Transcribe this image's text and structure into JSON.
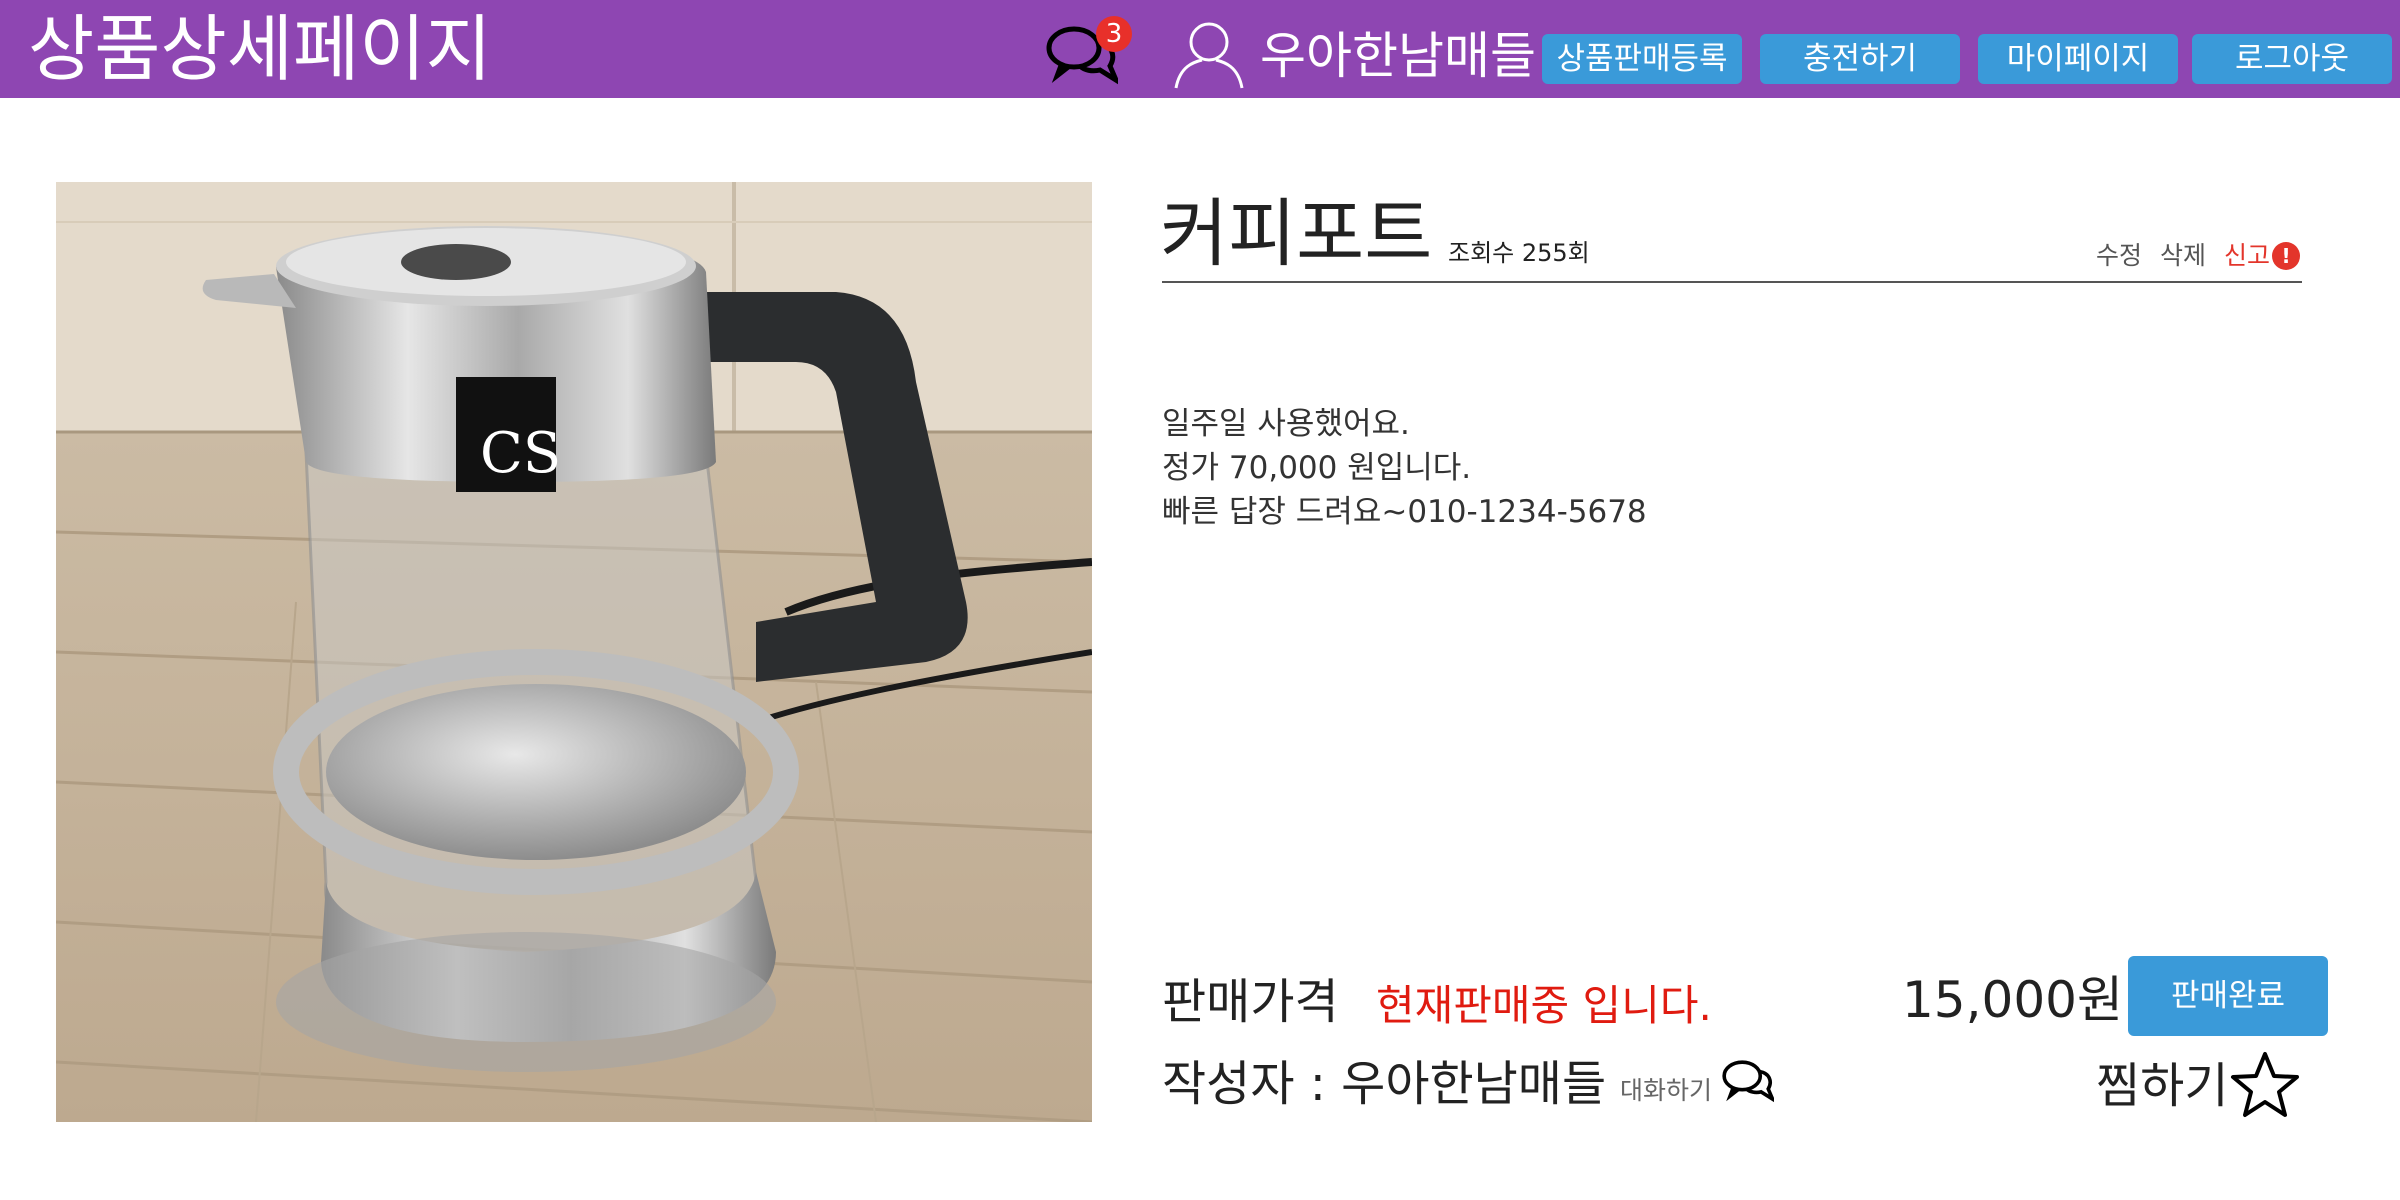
{
  "header": {
    "title": "상품상세페이지",
    "chat_badge_count": "3",
    "user_name": "우아한남매들",
    "register_label": "상품판매등록",
    "charge_label": "충전하기",
    "mypage_label": "마이페이지",
    "logout_label": "로그아웃",
    "bg_color": "#8e46b2",
    "button_color": "#3a9ad9"
  },
  "product": {
    "title": "커피포트",
    "view_count": "조회수 255회",
    "edit_label": "수정",
    "delete_label": "삭제",
    "report_label": "신고",
    "report_icon": "!",
    "description": [
      "일주일 사용했어요.",
      "정가 70,000 원입니다.",
      "빠른 답장 드려요~010-1234-5678"
    ],
    "price_label": "판매가격",
    "sale_status": "현재판매중 입니다.",
    "price": "15,000원",
    "sold_button_label": "판매완료",
    "author": "작성자 : 우아한남매들",
    "chat_label": "대화하기",
    "wish_label": "찜하기",
    "image_brand": "CS"
  },
  "icons": [
    "chat-bubbles-icon",
    "user-icon",
    "report-icon",
    "star-icon"
  ]
}
